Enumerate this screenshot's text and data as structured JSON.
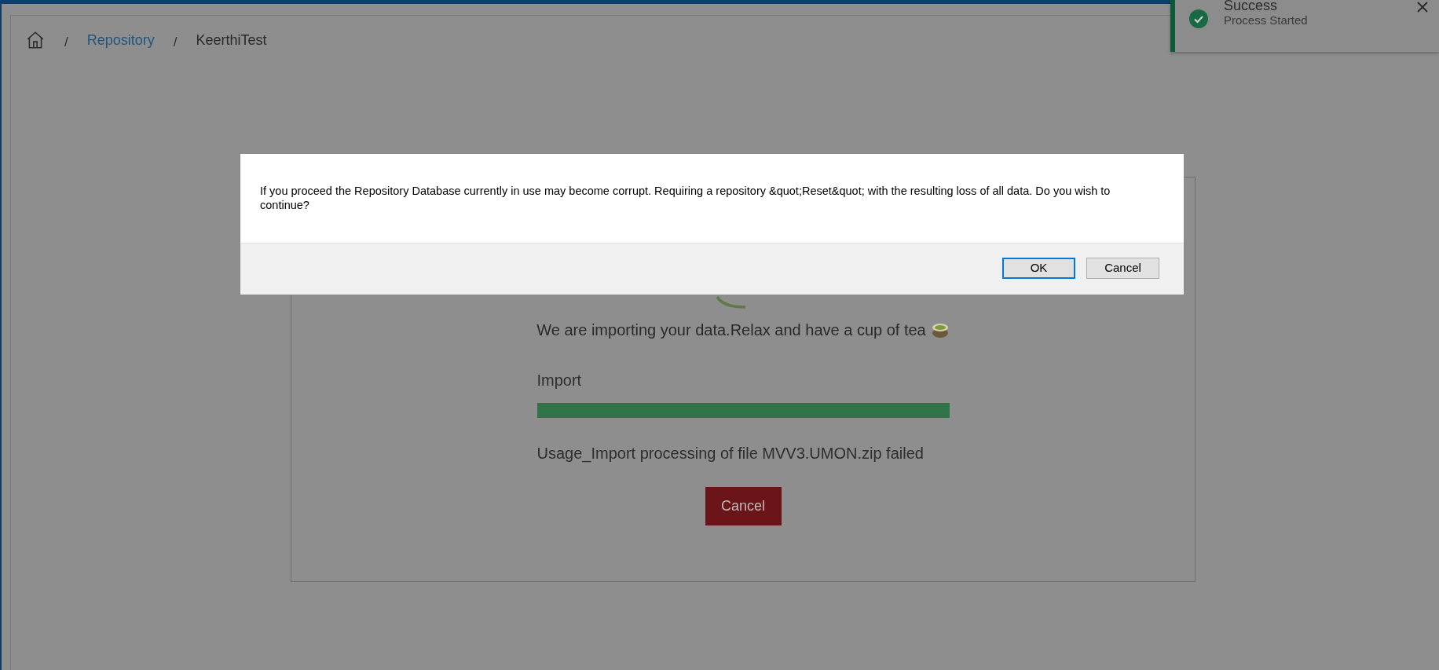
{
  "breadcrumb": [
    {
      "separator": "/",
      "label": "Repository",
      "kind": "link"
    },
    {
      "separator": "/",
      "label": "KeerthiTest",
      "kind": "current"
    }
  ],
  "import_panel": {
    "message": "We are importing your data.Relax and have a cup of tea",
    "progress": {
      "label": "Import",
      "level": 1
    },
    "status": "Usage_Import processing of file MVV3.UMON.zip failed",
    "cancel_button": "Cancel"
  },
  "dialog": {
    "message": "If you proceed the Repository Database currently in use may become corrupt. Requiring a repository &quot;Reset&quot; with the resulting loss of all data. Do you wish to continue?",
    "buttons": [
      {
        "label": "OK",
        "selected": true
      },
      {
        "label": "Cancel",
        "selected": false
      }
    ]
  },
  "toast": {
    "title": "Success",
    "message": "Process Started"
  }
}
